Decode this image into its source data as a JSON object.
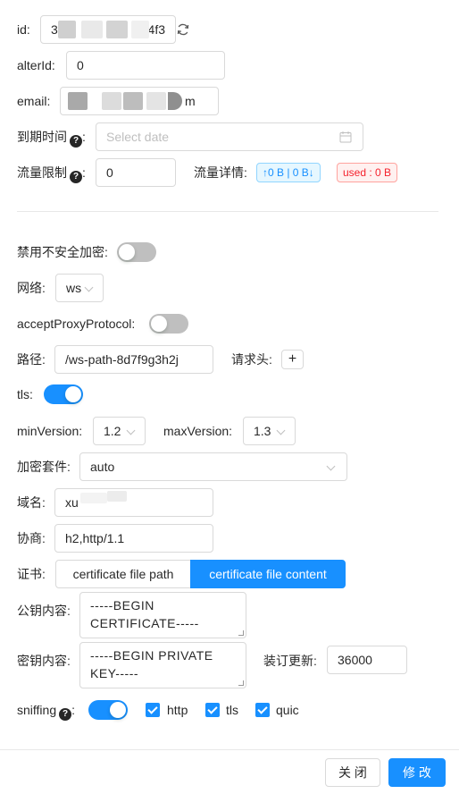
{
  "form": {
    "id": {
      "label": "id:",
      "value_start": "3",
      "value_end": "4f3"
    },
    "alterId": {
      "label": "alterId:",
      "value": "0"
    },
    "email": {
      "label": "email:",
      "value_end": "m"
    },
    "expiry": {
      "label": "到期时间",
      "placeholder": "Select date"
    },
    "traffic": {
      "label": "流量限制",
      "value": "0",
      "detail_label": "流量详情:",
      "updown_tag": "↑0 B | 0 B↓",
      "used_tag": "used : 0 B"
    },
    "insecure_encryption": {
      "label": "禁用不安全加密:",
      "enabled": false
    },
    "network": {
      "label": "网络:",
      "value": "ws"
    },
    "acceptProxyProtocol": {
      "label": "acceptProxyProtocol:",
      "enabled": false
    },
    "path": {
      "label": "路径:",
      "value": "/ws-path-8d7f9g3h2j",
      "headers_label": "请求头:",
      "add_symbol": "+"
    },
    "tls": {
      "label": "tls:",
      "enabled": true
    },
    "minVersion": {
      "label": "minVersion:",
      "value": "1.2"
    },
    "maxVersion": {
      "label": "maxVersion:",
      "value": "1.3"
    },
    "cipher": {
      "label": "加密套件:",
      "value": "auto"
    },
    "domain": {
      "label": "域名:",
      "value": "xu"
    },
    "alpn": {
      "label": "协商:",
      "value": "h2,http/1.1"
    },
    "certificate": {
      "label": "证书:",
      "option_path": "certificate file path",
      "option_content": "certificate file content",
      "selected": "certificate file content"
    },
    "public_key": {
      "label": "公钥内容:",
      "line1": "-----BEGIN",
      "line2": "CERTIFICATE-----"
    },
    "private_key": {
      "label": "密钥内容:",
      "line1": "-----BEGIN PRIVATE",
      "line2": "KEY-----"
    },
    "reload": {
      "label": "装订更新:",
      "value": "36000"
    },
    "sniffing": {
      "label": "sniffing",
      "enabled": true,
      "options": [
        {
          "label": "http",
          "checked": true
        },
        {
          "label": "tls",
          "checked": true
        },
        {
          "label": "quic",
          "checked": true
        }
      ]
    }
  },
  "footer": {
    "close_label": "关 闭",
    "submit_label": "修 改"
  },
  "colors": {
    "primary": "#1890ff",
    "danger": "#f5222d"
  }
}
